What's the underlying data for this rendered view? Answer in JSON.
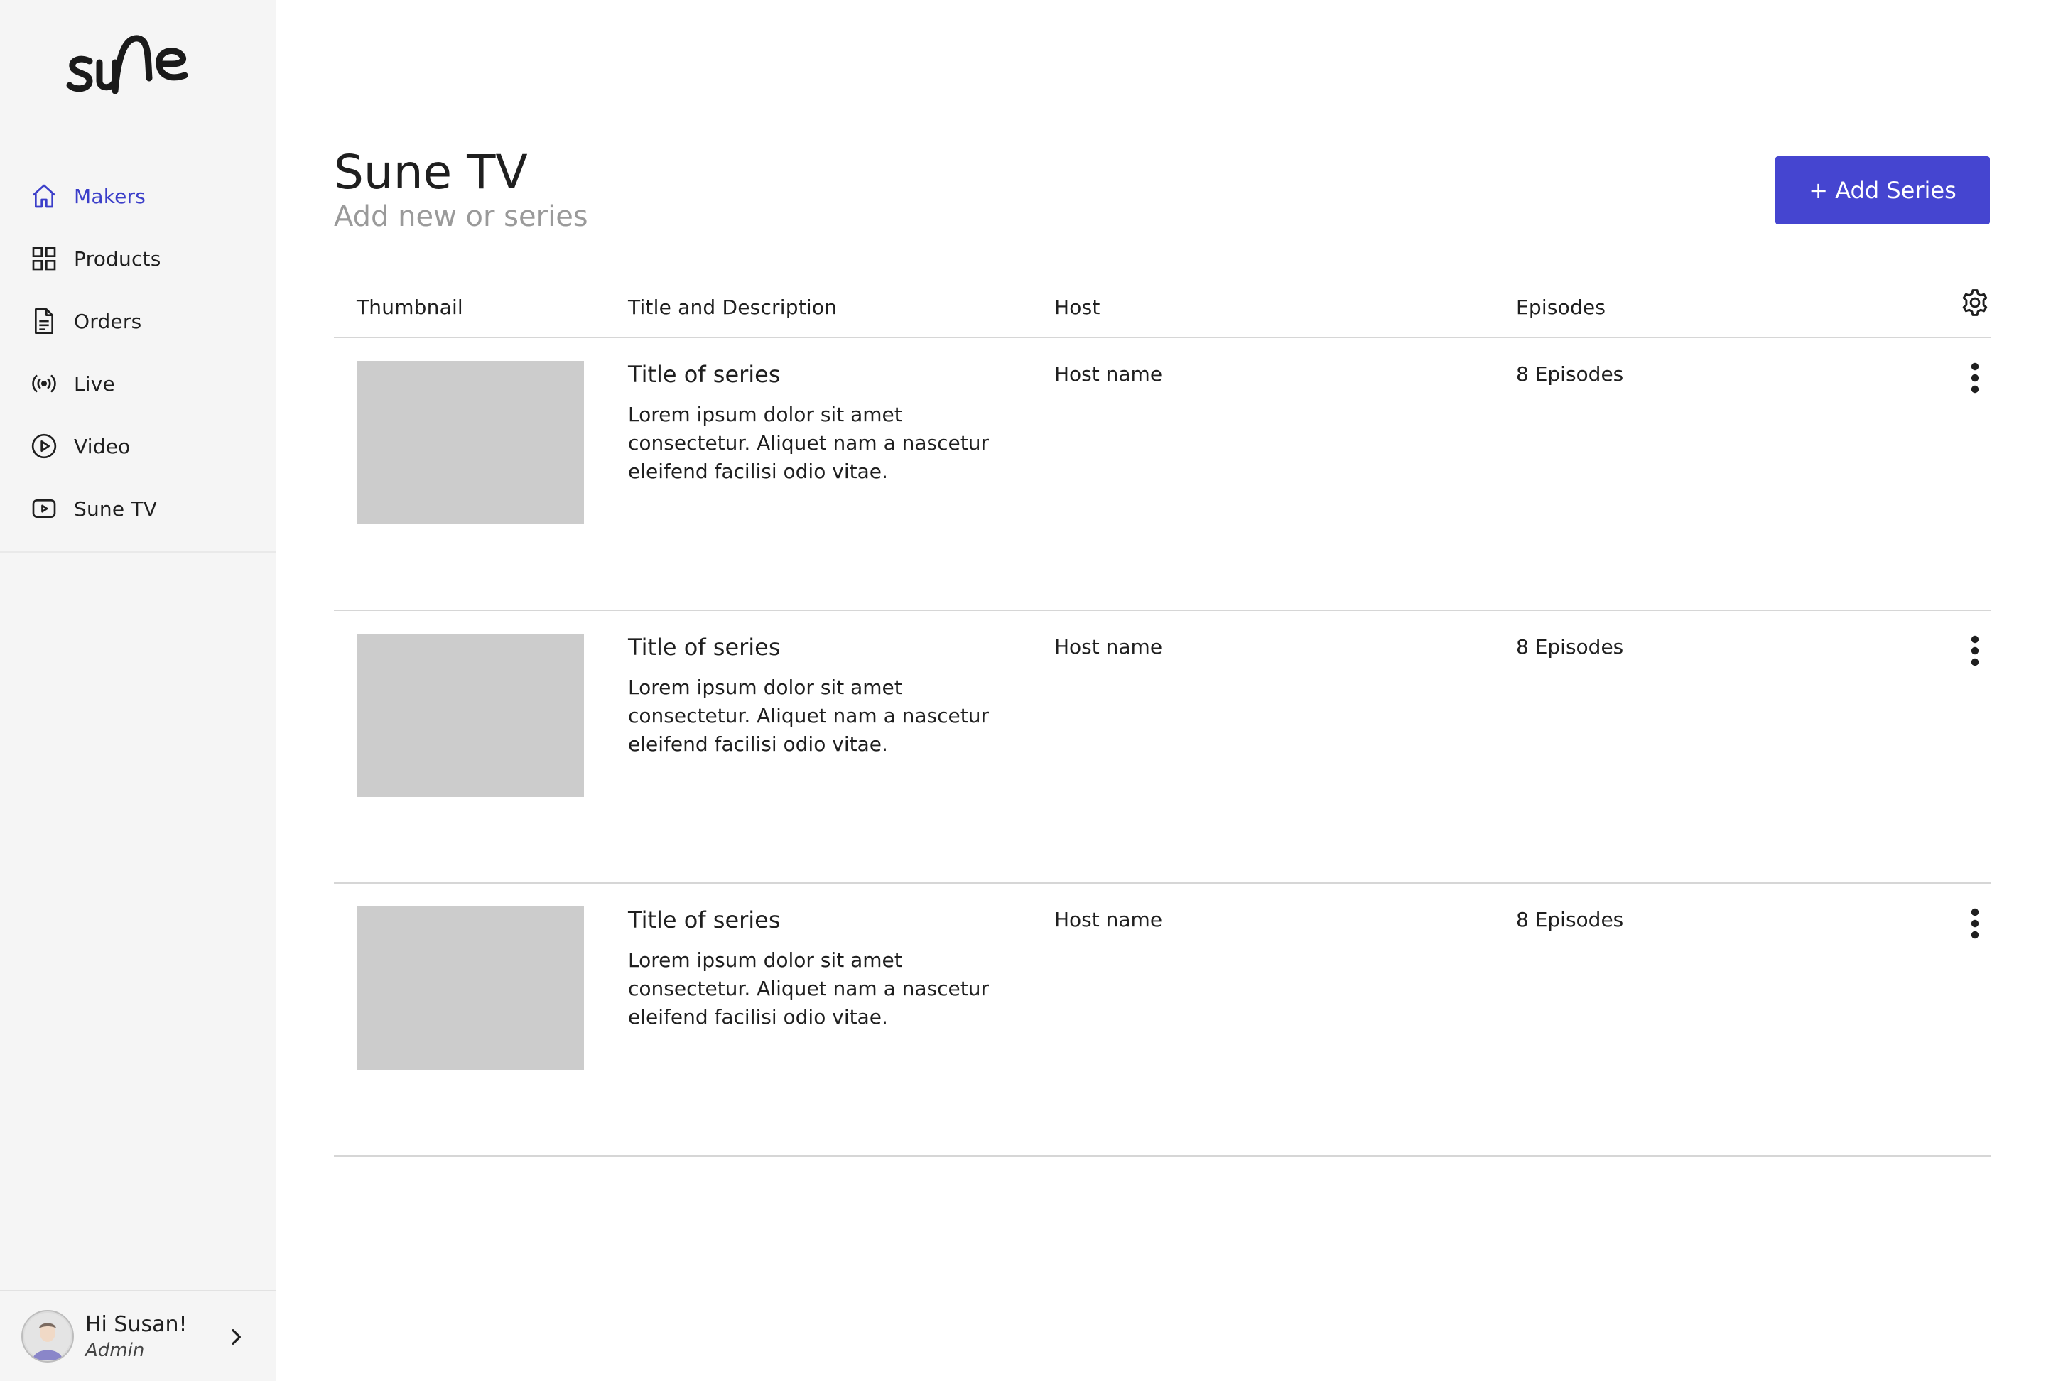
{
  "brand": {
    "logo_text": "sune"
  },
  "sidebar": {
    "items": [
      {
        "label": "Makers",
        "icon": "home-icon",
        "active": true
      },
      {
        "label": "Products",
        "icon": "grid-icon",
        "active": false
      },
      {
        "label": "Orders",
        "icon": "document-icon",
        "active": false
      },
      {
        "label": "Live",
        "icon": "broadcast-icon",
        "active": false
      },
      {
        "label": "Video",
        "icon": "play-circle-icon",
        "active": false
      },
      {
        "label": "Sune TV",
        "icon": "tv-play-icon",
        "active": false
      }
    ],
    "user": {
      "greeting": "Hi Susan!",
      "role": "Admin"
    }
  },
  "header": {
    "title": "Sune TV",
    "subtitle": "Add new or series",
    "add_button_label": "+ Add Series"
  },
  "table": {
    "columns": [
      "Thumbnail",
      "Title and Description",
      "Host",
      "Episodes"
    ],
    "rows": [
      {
        "title": "Title of series",
        "description": "Lorem ipsum dolor sit amet consectetur. Aliquet nam a nascetur eleifend facilisi odio vitae.",
        "host": "Host name",
        "episodes": "8 Episodes"
      },
      {
        "title": "Title of series",
        "description": "Lorem ipsum dolor sit amet consectetur. Aliquet nam a nascetur eleifend facilisi odio vitae.",
        "host": "Host name",
        "episodes": "8 Episodes"
      },
      {
        "title": "Title of series",
        "description": "Lorem ipsum dolor sit amet consectetur. Aliquet nam a nascetur eleifend facilisi odio vitae.",
        "host": "Host name",
        "episodes": "8 Episodes"
      }
    ]
  },
  "colors": {
    "accent": "#4545d0",
    "active_nav": "#3b3ec9",
    "sidebar_bg": "#f5f5f5",
    "thumbnail_placeholder": "#cccccc"
  }
}
